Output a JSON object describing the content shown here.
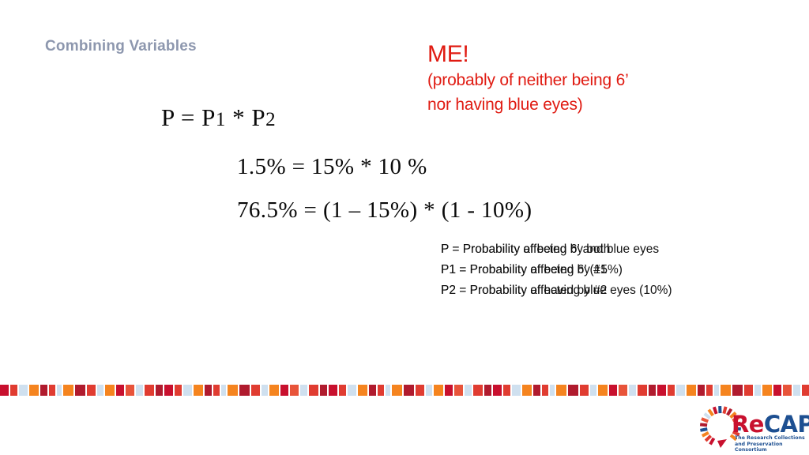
{
  "slide": {
    "title": "Combining Variables"
  },
  "callout": {
    "headline": "ME!",
    "line1": "(probably of neither being 6’",
    "line2": "nor having blue eyes)",
    "color": "#e01b12"
  },
  "equations": {
    "main": {
      "lhs": "P = P",
      "sub1": "1",
      "op": " * P",
      "sub2": "2"
    },
    "product": "1.5% = 15% * 10 %",
    "complement": "76.5% = (1 – 15%) * (1 - 10%)"
  },
  "legend": {
    "rows": [
      {
        "front": "P = Probability of being 6’ and blue eyes",
        "back": "P = Probability affected by both"
      },
      {
        "front": "P1 = Probability of being 6’ (15%)",
        "back": "P1 = Probability affected by #1"
      },
      {
        "front": "P2 = Probability of having blue eyes (10%)",
        "back": "P2 = Probability affected by #2"
      }
    ]
  },
  "decor_strip": {
    "colors": [
      "#c8102e",
      "#e8543a",
      "#cfe0ef",
      "#f5841f",
      "#b01b2e",
      "#e03c31"
    ],
    "pattern": [
      {
        "color": "#c8102e",
        "width": 11
      },
      {
        "color": "#e03c31",
        "width": 9
      },
      {
        "color": "#cfe0ef",
        "width": 11
      },
      {
        "color": "#f5841f",
        "width": 12
      },
      {
        "color": "#b01b2e",
        "width": 9
      },
      {
        "color": "#e03c31",
        "width": 8
      },
      {
        "color": "#cfe0ef",
        "width": 6
      },
      {
        "color": "#f5841f",
        "width": 13
      },
      {
        "color": "#b01b2e",
        "width": 13
      },
      {
        "color": "#e03c31",
        "width": 11
      },
      {
        "color": "#cfe0ef",
        "width": 8
      },
      {
        "color": "#f5841f",
        "width": 12
      },
      {
        "color": "#c8102e",
        "width": 10
      },
      {
        "color": "#e8543a",
        "width": 11
      },
      {
        "color": "#cfe0ef",
        "width": 9
      },
      {
        "color": "#e03c31",
        "width": 12
      },
      {
        "color": "#b01b2e",
        "width": 9
      }
    ]
  },
  "logo": {
    "name_part1": "Re",
    "name_part2": "CAP",
    "tagline_line1": "The Research Collections",
    "tagline_line2": "and Preservation Consortium",
    "brand_blue": "#1d4f91",
    "brand_red": "#c8102e",
    "arc_colors": [
      "#c8102e",
      "#e03c31",
      "#f5841f",
      "#1d4f91",
      "#b01b2e",
      "#e8543a",
      "#cfe0ef",
      "#f5841f",
      "#c8102e",
      "#1d4f91",
      "#e03c31",
      "#b01b2e",
      "#f5841f",
      "#e8543a",
      "#c8102e",
      "#1d4f91",
      "#e03c31",
      "#f5841f"
    ]
  }
}
